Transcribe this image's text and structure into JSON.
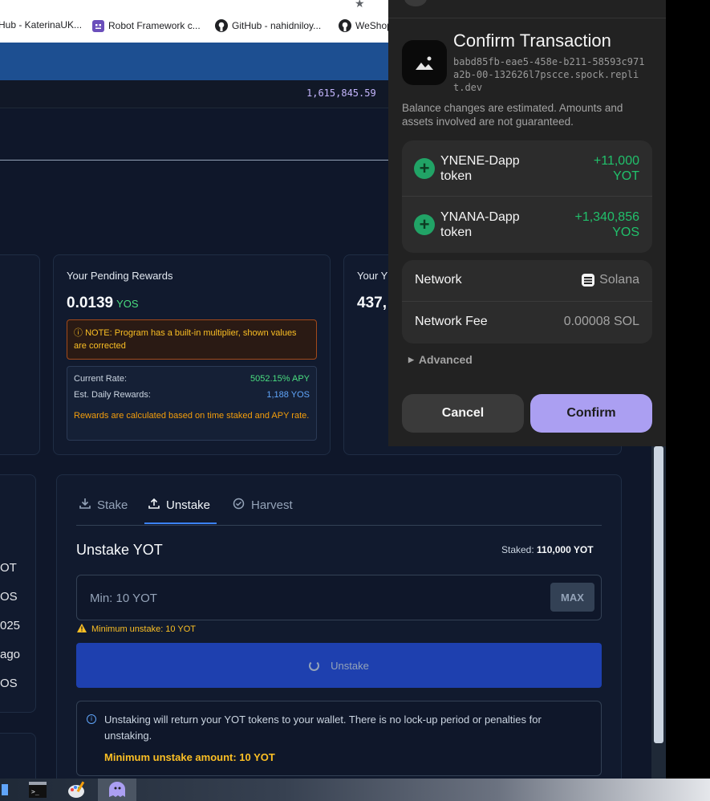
{
  "browser": {
    "bookmarks": [
      {
        "label": "Hub - KaterinaUK...",
        "icon": "github-icon"
      },
      {
        "label": "Robot Framework c...",
        "icon": "robot-icon"
      },
      {
        "label": "GitHub - nahidniloy...",
        "icon": "github-icon"
      },
      {
        "label": "WeShop",
        "icon": "github-icon"
      }
    ]
  },
  "app": {
    "ticker_value": "1,615,845.59",
    "left_list": [
      "OT",
      "OS",
      "025",
      "ago",
      "OS"
    ],
    "pending_rewards": {
      "title": "Your Pending Rewards",
      "value": "0.0139",
      "unit": "YOS",
      "note": "NOTE: Program has a built-in multiplier, shown values are corrected",
      "current_rate_label": "Current Rate:",
      "current_rate_value": "5052.15% APY",
      "daily_label": "Est. Daily Rewards:",
      "daily_value": "1,188 YOS",
      "calc_note": "Rewards are calculated based on time staked and APY rate."
    },
    "your_card": {
      "title": "Your Y",
      "value": "437,"
    },
    "tabs": [
      {
        "label": "Stake",
        "icon": "download-icon",
        "active": false
      },
      {
        "label": "Unstake",
        "icon": "upload-icon",
        "active": true
      },
      {
        "label": "Harvest",
        "icon": "check-circle-icon",
        "active": false
      }
    ],
    "unstake": {
      "heading": "Unstake YOT",
      "staked_label": "Staked:",
      "staked_value": "110,000 YOT",
      "amount_placeholder": "Min: 10 YOT",
      "max_label": "MAX",
      "warning": "Minimum unstake: 10 YOT",
      "button_label": "Unstake",
      "info_text": "Unstaking will return your YOT tokens to your wallet. There is no lock-up period or penalties for unstaking.",
      "info_min": "Minimum unstake amount: 10 YOT"
    }
  },
  "wallet": {
    "title": "Confirm Transaction",
    "domain": "babd85fb-eae5-458e-b211-58593c971a2b-00-132626l7pscce.spock.replit.dev",
    "disclaimer": "Balance changes are estimated. Amounts and assets involved are not guaranteed.",
    "changes": [
      {
        "token": "YNENE-Dapp token",
        "amount": "+11,000",
        "unit": "YOT"
      },
      {
        "token": "YNANA-Dapp token",
        "amount": "+1,340,856",
        "unit": "YOS"
      }
    ],
    "network_label": "Network",
    "network_value": "Solana",
    "fee_label": "Network Fee",
    "fee_value": "0.00008 SOL",
    "advanced_label": "Advanced",
    "cancel_label": "Cancel",
    "confirm_label": "Confirm",
    "accent": "#ab9ff2",
    "positive": "#21c06b"
  }
}
